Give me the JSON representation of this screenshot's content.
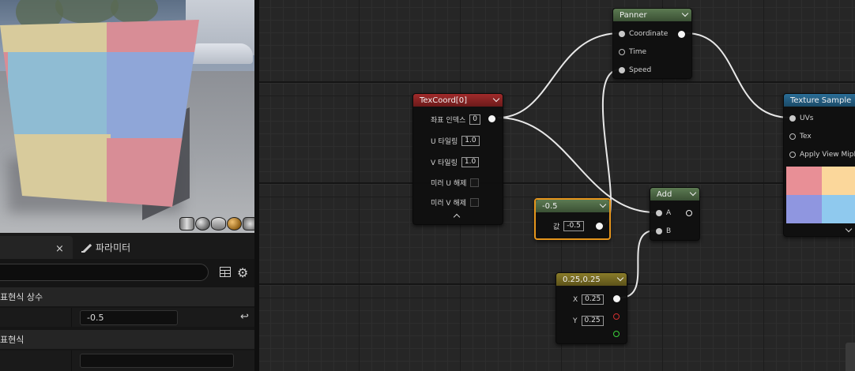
{
  "details": {
    "tab_close_glyph": "×",
    "tab_parameters_label": "파라미터",
    "search_placeholder": "",
    "category_constant": "표현식 상수",
    "constant_value": "-0.5",
    "category_expression": "표현식",
    "expression_value": "",
    "icons": [
      "close-icon",
      "pencil-icon",
      "table-icon",
      "gear-icon",
      "reset-arrow-icon"
    ]
  },
  "graph": {
    "nodes": {
      "panner": {
        "title": "Panner",
        "pins": [
          "Coordinate",
          "Time",
          "Speed"
        ]
      },
      "texcoord": {
        "title": "TexCoord[0]",
        "coord_index_label": "좌표 인덱스",
        "coord_index_value": "0",
        "u_tiling_label": "U 타일링",
        "u_tiling_value": "1.0",
        "v_tiling_label": "V 타일링",
        "v_tiling_value": "1.0",
        "mirror_u_label": "미러 U 해제",
        "mirror_v_label": "미러 V 해제"
      },
      "texture_sample": {
        "title": "Texture Sample",
        "pins": [
          "UVs",
          "Tex",
          "Apply View MipBi"
        ],
        "preview_colors": [
          "#e88f96",
          "#fbd79b",
          "#8f96e0",
          "#8fc9ee"
        ]
      },
      "constant": {
        "title": "-0.5",
        "value_label": "값",
        "value": "-0.5"
      },
      "add": {
        "title": "Add",
        "pins": [
          "A",
          "B"
        ]
      },
      "constant2": {
        "title": "0.25,0.25",
        "x_label": "X",
        "x_value": "0.25",
        "y_label": "Y",
        "y_value": "0.25"
      }
    }
  },
  "preview_face_colors": {
    "red": "#d88d96",
    "yellow": "#d8cb9c",
    "blue": "#8fa6d8",
    "cyan": "#8fbcd3"
  },
  "viewport_toolbar": [
    "cylinder-icon",
    "sphere-icon",
    "plane-icon",
    "cube-icon",
    "teapot-icon"
  ]
}
